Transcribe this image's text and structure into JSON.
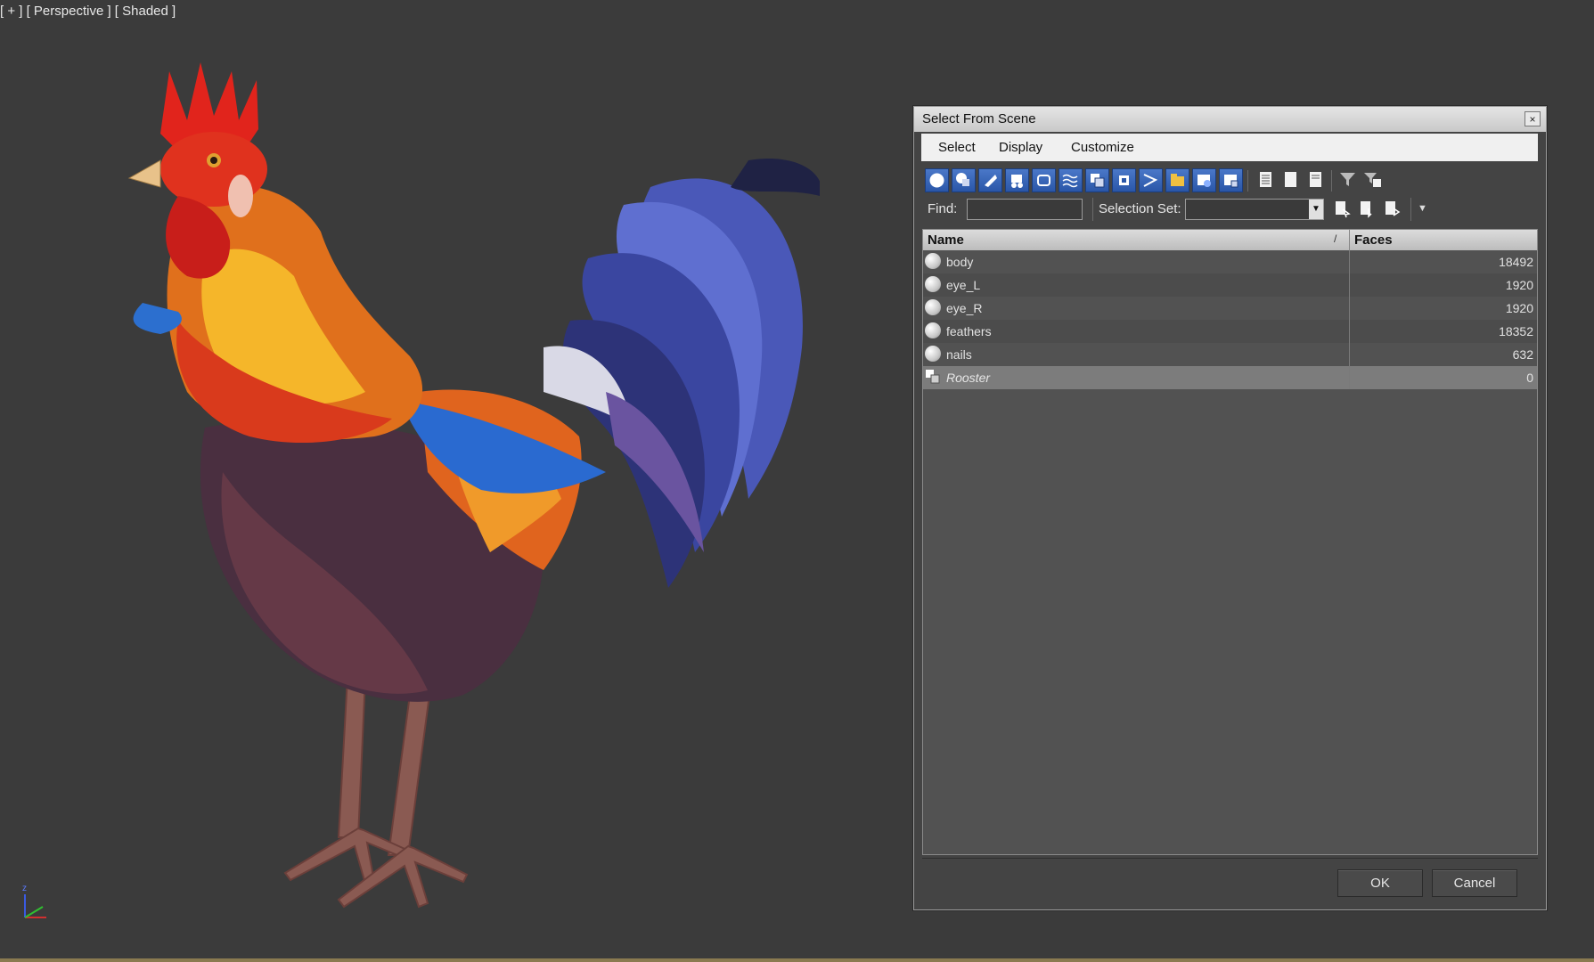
{
  "viewport": {
    "label": "[ + ] [ Perspective ] [ Shaded ]",
    "axis_z": "z"
  },
  "dialog": {
    "title": "Select From Scene",
    "close_glyph": "×",
    "menu": [
      "Select",
      "Display",
      "Customize"
    ],
    "toolbar_icons": [
      "display-geometry-icon",
      "display-shapes-icon",
      "display-lights-icon",
      "display-cameras-icon",
      "display-helpers-icon",
      "display-spacewarps-icon",
      "display-groups-icon",
      "display-xrefs-icon",
      "display-bones-icon",
      "display-containers-icon",
      "display-frozen-icon",
      "display-hidden-icon",
      "select-all-icon",
      "select-none-icon",
      "select-invert-icon",
      "filter-icon",
      "filter-options-icon"
    ],
    "find_label": "Find:",
    "find_value": "",
    "selection_set_label": "Selection Set:",
    "selection_set_value": "",
    "columns": {
      "name": "Name",
      "faces": "Faces"
    },
    "rows": [
      {
        "name": "body",
        "faces": "18492",
        "icon": "geometry-icon"
      },
      {
        "name": "eye_L",
        "faces": "1920",
        "icon": "geometry-icon"
      },
      {
        "name": "eye_R",
        "faces": "1920",
        "icon": "geometry-icon"
      },
      {
        "name": "feathers",
        "faces": "18352",
        "icon": "geometry-icon"
      },
      {
        "name": "nails",
        "faces": "632",
        "icon": "geometry-icon"
      },
      {
        "name": "Rooster",
        "faces": "0",
        "icon": "group-icon"
      }
    ],
    "ok_label": "OK",
    "cancel_label": "Cancel"
  },
  "colors": {
    "viewport_bg": "#3b3b3b",
    "toolbar_blue": "#2a56a8",
    "selected_row": "#7c7c7c"
  }
}
